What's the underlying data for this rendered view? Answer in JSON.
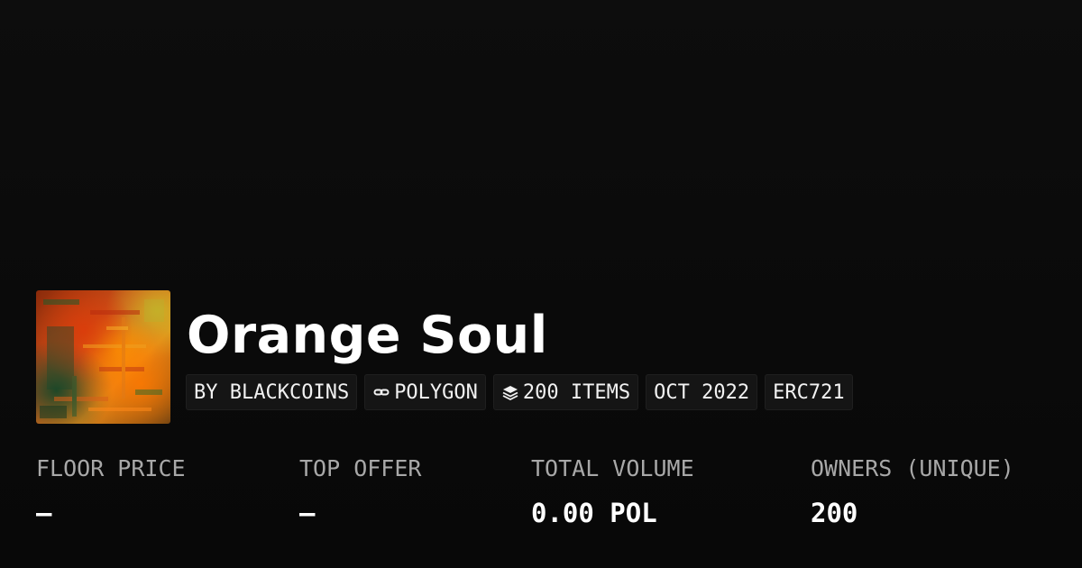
{
  "collection": {
    "title": "Orange Soul",
    "thumbnail_icon": "artwork-thumbnail"
  },
  "tags": [
    {
      "label": "BY BLACKCOINS",
      "icon": null
    },
    {
      "label": "POLYGON",
      "icon": "link-chain-icon"
    },
    {
      "label": "200 ITEMS",
      "icon": "layers-icon"
    },
    {
      "label": "OCT 2022",
      "icon": null
    },
    {
      "label": "ERC721",
      "icon": null
    }
  ],
  "stats": [
    {
      "label": "FLOOR PRICE",
      "value": "–"
    },
    {
      "label": "TOP OFFER",
      "value": "–"
    },
    {
      "label": "TOTAL VOLUME",
      "value": "0.00 POL"
    },
    {
      "label": "OWNERS (UNIQUE)",
      "value": "200"
    }
  ],
  "colors": {
    "background": "#0b0b0b",
    "tag_background": "#151515",
    "label_gray": "#a8a8a8",
    "text_white": "#ffffff"
  }
}
